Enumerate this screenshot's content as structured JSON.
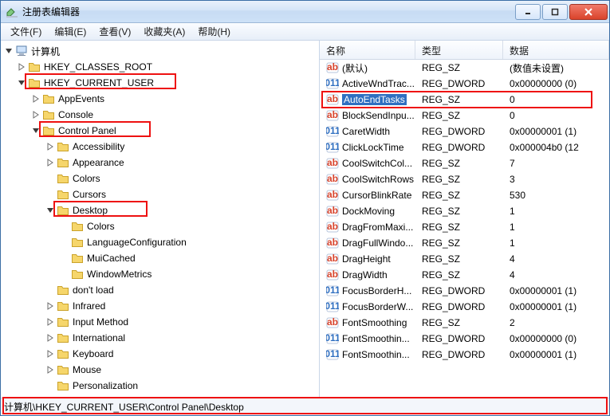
{
  "window": {
    "title": "注册表编辑器",
    "title_rest": "",
    "min_tip": "Minimize",
    "max_tip": "Maximize",
    "close_tip": "Close"
  },
  "menu": {
    "file": "文件(F)",
    "edit": "编辑(E)",
    "view": "查看(V)",
    "fav": "收藏夹(A)",
    "help": "帮助(H)"
  },
  "tree": {
    "root": "计算机",
    "hkcr": "HKEY_CLASSES_ROOT",
    "hkcu": "HKEY_CURRENT_USER",
    "appevents": "AppEvents",
    "console": "Console",
    "controlpanel": "Control Panel",
    "accessibility": "Accessibility",
    "appearance": "Appearance",
    "colors": "Colors",
    "cursors": "Cursors",
    "desktop": "Desktop",
    "desktop_colors": "Colors",
    "langconf": "LanguageConfiguration",
    "muicached": "MuiCached",
    "windowmetrics": "WindowMetrics",
    "dontload": "don't load",
    "infrared": "Infrared",
    "inputmethod": "Input Method",
    "international": "International",
    "keyboard": "Keyboard",
    "mouse": "Mouse",
    "personalization": "Personalization"
  },
  "list": {
    "header": {
      "name": "名称",
      "type": "类型",
      "data": "数据"
    },
    "rows": [
      {
        "icon": "sz",
        "name": "(默认)",
        "type": "REG_SZ",
        "data": "(数值未设置)"
      },
      {
        "icon": "dw",
        "name": "ActiveWndTrac...",
        "type": "REG_DWORD",
        "data": "0x00000000 (0)"
      },
      {
        "icon": "sz",
        "name": "AutoEndTasks",
        "type": "REG_SZ",
        "data": "0",
        "selected": true
      },
      {
        "icon": "sz",
        "name": "BlockSendInpu...",
        "type": "REG_SZ",
        "data": "0"
      },
      {
        "icon": "dw",
        "name": "CaretWidth",
        "type": "REG_DWORD",
        "data": "0x00000001 (1)"
      },
      {
        "icon": "dw",
        "name": "ClickLockTime",
        "type": "REG_DWORD",
        "data": "0x000004b0 (12"
      },
      {
        "icon": "sz",
        "name": "CoolSwitchCol...",
        "type": "REG_SZ",
        "data": "7"
      },
      {
        "icon": "sz",
        "name": "CoolSwitchRows",
        "type": "REG_SZ",
        "data": "3"
      },
      {
        "icon": "sz",
        "name": "CursorBlinkRate",
        "type": "REG_SZ",
        "data": "530"
      },
      {
        "icon": "sz",
        "name": "DockMoving",
        "type": "REG_SZ",
        "data": "1"
      },
      {
        "icon": "sz",
        "name": "DragFromMaxi...",
        "type": "REG_SZ",
        "data": "1"
      },
      {
        "icon": "sz",
        "name": "DragFullWindo...",
        "type": "REG_SZ",
        "data": "1"
      },
      {
        "icon": "sz",
        "name": "DragHeight",
        "type": "REG_SZ",
        "data": "4"
      },
      {
        "icon": "sz",
        "name": "DragWidth",
        "type": "REG_SZ",
        "data": "4"
      },
      {
        "icon": "dw",
        "name": "FocusBorderH...",
        "type": "REG_DWORD",
        "data": "0x00000001 (1)"
      },
      {
        "icon": "dw",
        "name": "FocusBorderW...",
        "type": "REG_DWORD",
        "data": "0x00000001 (1)"
      },
      {
        "icon": "sz",
        "name": "FontSmoothing",
        "type": "REG_SZ",
        "data": "2"
      },
      {
        "icon": "dw",
        "name": "FontSmoothin...",
        "type": "REG_DWORD",
        "data": "0x00000000 (0)"
      },
      {
        "icon": "dw",
        "name": "FontSmoothin...",
        "type": "REG_DWORD",
        "data": "0x00000001 (1)"
      }
    ]
  },
  "status": {
    "path": "计算机\\HKEY_CURRENT_USER\\Control Panel\\Desktop"
  }
}
